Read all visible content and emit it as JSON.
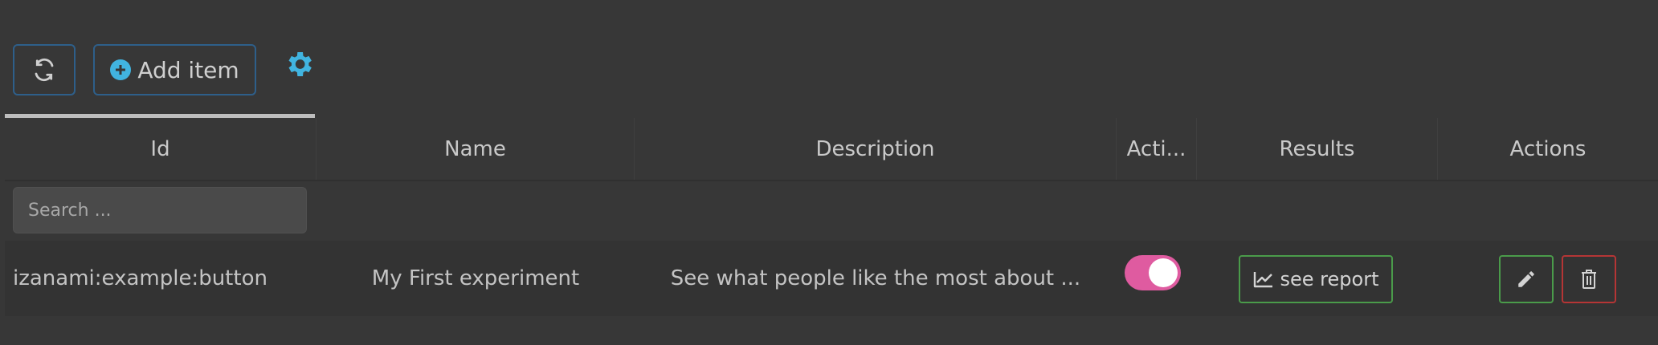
{
  "toolbar": {
    "add_item_label": "Add item",
    "refresh_icon": "refresh-icon",
    "plus_icon": "plus-circle-icon",
    "settings_icon": "gear-icon",
    "accent_color": "#41b4e0"
  },
  "table": {
    "columns": [
      "Id",
      "Name",
      "Description",
      "Acti...",
      "Results",
      "Actions"
    ],
    "search_placeholder": "Search ...",
    "rows": [
      {
        "id": "izanami:example:button",
        "name": "My First experiment",
        "description": "See what people like the most about ...",
        "active": true,
        "results_label": "see report"
      }
    ]
  },
  "colors": {
    "toggle_on": "#df5ba0",
    "success_border": "#4a9b4a",
    "danger_border": "#b53535"
  }
}
